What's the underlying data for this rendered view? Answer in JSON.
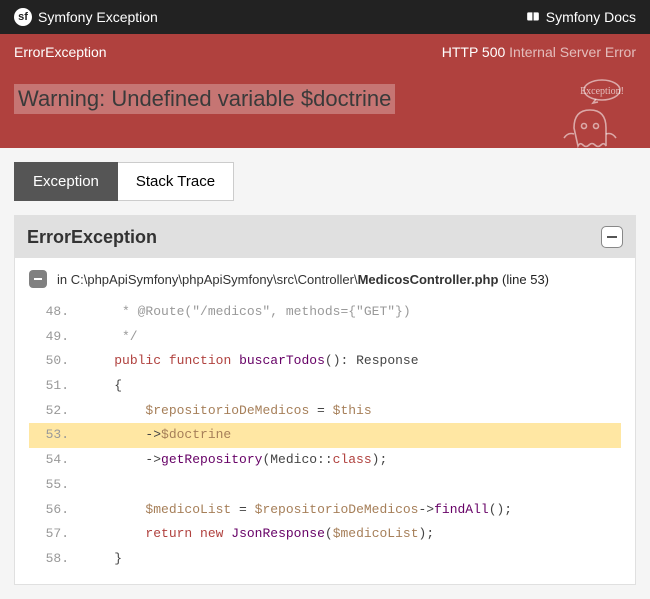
{
  "header": {
    "brand": "Symfony Exception",
    "docs_label": "Symfony Docs"
  },
  "banner": {
    "exception_class": "ErrorException",
    "http_code": "HTTP 500",
    "http_text": "Internal Server Error",
    "title": "Warning: Undefined variable $doctrine",
    "ghost_bubble": "Exception!"
  },
  "tabs": {
    "exception": "Exception",
    "stack_trace": "Stack Trace"
  },
  "panel": {
    "heading": "ErrorException"
  },
  "trace": {
    "path_prefix": "in C:\\phpApiSymfony\\phpApiSymfony\\src\\Controller\\",
    "file": "MedicosController.php",
    "line_label": " (line 53)"
  },
  "code": {
    "lines": [
      {
        "n": "48.",
        "html": "     * @Route(\"/medicos\", methods={\"GET\"})",
        "cls": "c"
      },
      {
        "n": "49.",
        "html": "     */",
        "cls": "c"
      },
      {
        "n": "50.",
        "kw1": "public",
        "kw2": "function",
        "fn": "buscarTodos",
        "rest": "(): Response"
      },
      {
        "n": "51.",
        "html": "    {"
      },
      {
        "n": "52.",
        "v": "$repositorioDeMedicos",
        "rest": " = ",
        "v2": "$this"
      },
      {
        "n": "53.",
        "arrow": "->",
        "v": "$doctrine",
        "highlight": true
      },
      {
        "n": "54.",
        "arrow": "->",
        "fn": "getRepository",
        "rest": "(Medico::",
        "kw": "class",
        "rest2": ");"
      },
      {
        "n": "55.",
        "html": ""
      },
      {
        "n": "56.",
        "v": "$medicoList",
        "rest": " = ",
        "v2": "$repositorioDeMedicos",
        "arrow": "->",
        "fn": "findAll",
        "rest2": "();"
      },
      {
        "n": "57.",
        "kw": "return",
        "kw2": "new",
        "fn": "JsonResponse",
        "rest": "(",
        "v": "$medicoList",
        "rest2": ");"
      },
      {
        "n": "58.",
        "html": "    }"
      }
    ]
  }
}
